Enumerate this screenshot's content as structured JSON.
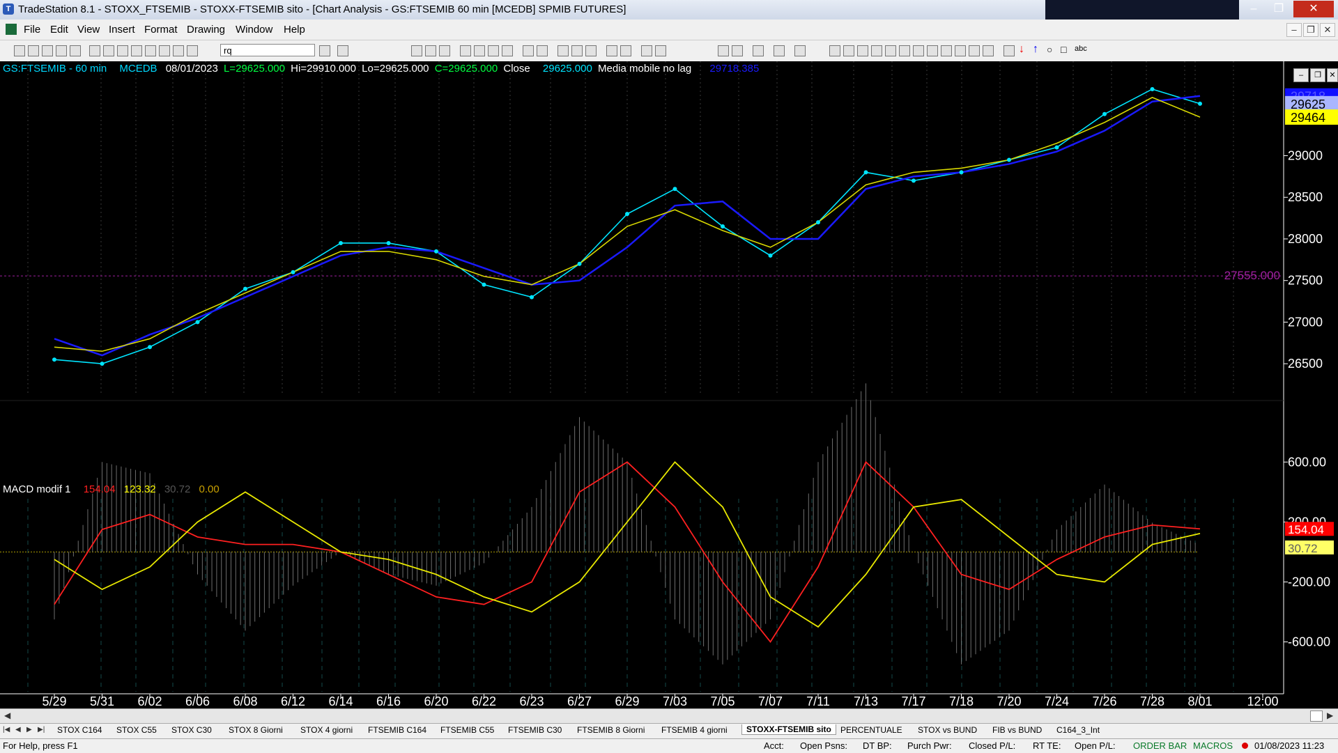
{
  "window": {
    "app_icon": "tradestation-icon",
    "title": "TradeStation 8.1 - STOXX_FTSEMIB - STOXX-FTSEMIB sito - [Chart Analysis - GS:FTSEMIB  60 min  [MCEDB] SPMIB FUTURES]",
    "buttons": [
      "minimize-icon",
      "restore-icon",
      "close-icon"
    ]
  },
  "menu": [
    "File",
    "Edit",
    "View",
    "Insert",
    "Format",
    "Drawing",
    "Window",
    "Help"
  ],
  "toolbar": {
    "symbol_value": "rq"
  },
  "price_header": {
    "symbol": "GS:FTSEMIB - 60 min",
    "exchange": "MCEDB",
    "date": "08/01/2023",
    "last": "L=29625.000",
    "high": "Hi=29910.000",
    "low": "Lo=29625.000",
    "close": "C=29625.000",
    "close_label": "Close",
    "close_value": "29625.000",
    "indicator": "Media mobile no lag",
    "indicator_value": "29718.385"
  },
  "macd_header": {
    "name": "MACD modif 1",
    "v1": "154.04",
    "v2": "123.32",
    "v3": "30.72",
    "v4": "0.00"
  },
  "price_axis": {
    "ticks": [
      "29000",
      "28500",
      "28000",
      "27500",
      "27000",
      "26500"
    ],
    "tick_values": [
      29000,
      28500,
      28000,
      27500,
      27000,
      26500
    ],
    "range": [
      26200,
      29900
    ],
    "tags": [
      {
        "text": "29718",
        "value": 29718,
        "bg": "#1010ff",
        "fg": "#5858ff"
      },
      {
        "text": "29625",
        "value": 29625,
        "bg": "#aab6ff",
        "fg": "#000000"
      },
      {
        "text": "29464",
        "value": 29464,
        "bg": "#ffff00",
        "fg": "#000000"
      }
    ],
    "hline": {
      "text": "27555.000",
      "value": 27555,
      "color": "#a020a0"
    }
  },
  "macd_axis": {
    "ticks": [
      "600.00",
      "200.00",
      "-200.00",
      "-600.00"
    ],
    "tick_values": [
      600,
      200,
      -200,
      -600
    ],
    "range": [
      -900,
      950
    ],
    "tags": [
      {
        "text": "154.04",
        "value": 154,
        "bg": "#ff0000",
        "fg": "#ffffff"
      },
      {
        "text": "30.72",
        "value": 30,
        "bg": "#ffff66",
        "fg": "#606060"
      }
    ]
  },
  "time_axis": [
    "5/29",
    "5/31",
    "6/02",
    "6/06",
    "6/08",
    "6/12",
    "6/14",
    "6/16",
    "6/20",
    "6/22",
    "6/23",
    "6/27",
    "6/29",
    "7/03",
    "7/05",
    "7/07",
    "7/11",
    "7/13",
    "7/17",
    "7/18",
    "7/20",
    "7/24",
    "7/26",
    "7/28",
    "8/01",
    "12:00"
  ],
  "chart_data": {
    "type": "line",
    "x": [
      "5/29",
      "5/31",
      "6/02",
      "6/06",
      "6/08",
      "6/12",
      "6/14",
      "6/16",
      "6/20",
      "6/22",
      "6/23",
      "6/27",
      "6/29",
      "7/03",
      "7/05",
      "7/07",
      "7/11",
      "7/13",
      "7/17",
      "7/18",
      "7/20",
      "7/24",
      "7/26",
      "7/28",
      "8/01"
    ],
    "series": [
      {
        "color": "#00e5ff",
        "values": [
          26550,
          26500,
          26700,
          27000,
          27400,
          27600,
          27950,
          27950,
          27850,
          27450,
          27300,
          27700,
          28300,
          28600,
          28150,
          27800,
          28200,
          28800,
          28700,
          28800,
          28950,
          29100,
          29500,
          29800,
          29625
        ]
      },
      {
        "color": "#1a1aff",
        "values": [
          26800,
          26600,
          26850,
          27050,
          27300,
          27550,
          27800,
          27900,
          27850,
          27650,
          27450,
          27500,
          27900,
          28400,
          28450,
          28000,
          28000,
          28600,
          28750,
          28800,
          28900,
          29050,
          29300,
          29650,
          29718
        ]
      },
      {
        "color": "#d8d800",
        "values": [
          26700,
          26650,
          26800,
          27100,
          27350,
          27600,
          27850,
          27850,
          27750,
          27550,
          27450,
          27700,
          28150,
          28350,
          28100,
          27900,
          28200,
          28650,
          28800,
          28850,
          28950,
          29150,
          29400,
          29700,
          29464
        ]
      }
    ],
    "macd_series": [
      {
        "color": "#ff2020",
        "values": [
          -350,
          150,
          250,
          100,
          50,
          50,
          0,
          -150,
          -300,
          -350,
          -200,
          400,
          600,
          300,
          -200,
          -600,
          -100,
          600,
          300,
          -150,
          -250,
          -50,
          100,
          180,
          154
        ]
      },
      {
        "color": "#e8e800",
        "values": [
          -50,
          -250,
          -100,
          200,
          400,
          200,
          0,
          -50,
          -150,
          -300,
          -400,
          -200,
          200,
          600,
          300,
          -300,
          -500,
          -150,
          300,
          350,
          100,
          -150,
          -200,
          50,
          123
        ]
      }
    ],
    "ylim": [
      26200,
      29900
    ]
  },
  "tabs": [
    "STOX C164",
    "STOX C55",
    "STOX  C30",
    "STOX  8 Giorni",
    "STOX 4 giorni",
    "FTSEMIB C164",
    "FTSEMIB C55",
    "FTSEMIB C30",
    "FTSEMIB  8 Giorni",
    "FTSEMIB  4 giorni",
    "STOXX-FTSEMIB sito",
    "PERCENTUALE",
    "STOX vs BUND",
    "FIB vs BUND",
    "C164_3_Int"
  ],
  "tab_nav": [
    "|◀",
    "◀",
    "▶",
    "▶|"
  ],
  "status": {
    "help": "For Help, press F1",
    "acct": "Acct:",
    "open_psns": "Open Psns:",
    "dt_bp": "DT BP:",
    "purch_pwr": "Purch Pwr:",
    "closed_pl": "Closed P/L:",
    "rt_te": "RT TE:",
    "open_pl": "Open P/L:",
    "order_bar": "ORDER BAR",
    "macros": "MACROS",
    "datetime": "01/08/2023 11:23"
  }
}
